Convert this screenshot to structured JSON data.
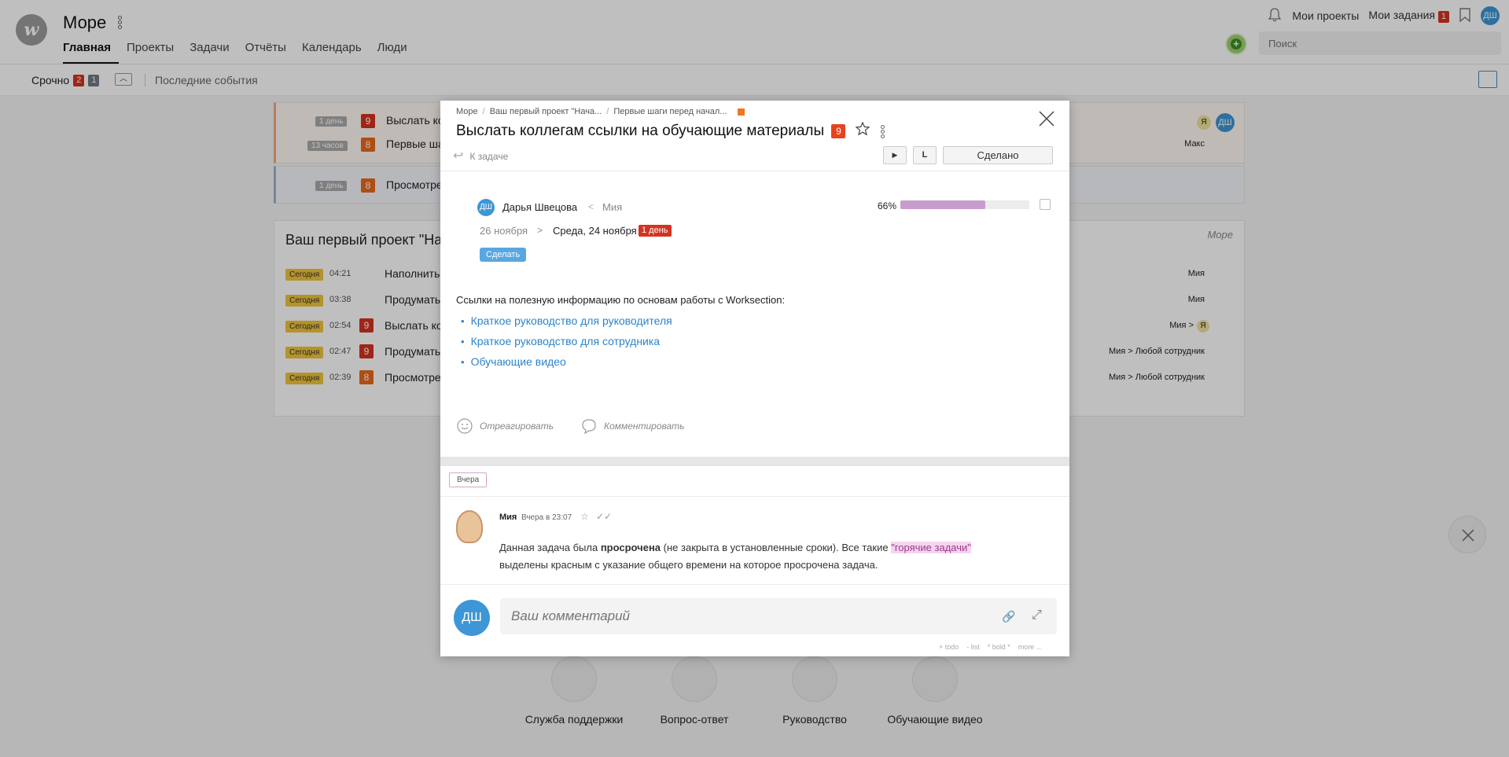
{
  "header": {
    "logo": "w",
    "title": "Море",
    "nav": [
      "Главная",
      "Проекты",
      "Задачи",
      "Отчёты",
      "Календарь",
      "Люди"
    ],
    "my_projects": "Мои проекты",
    "my_tasks": "Мои задания",
    "my_tasks_count": "1",
    "user_initials": "ДШ",
    "search_placeholder": "Поиск"
  },
  "subbar": {
    "urgent_label": "Срочно",
    "urgent_count_red": "2",
    "urgent_count_grey": "1",
    "recent_events": "Последние события"
  },
  "background": {
    "urgent_rows": [
      {
        "time": "1 день",
        "priority": "9",
        "text": "Выслать ко",
        "assignees": [
          "Я",
          "ДШ"
        ]
      },
      {
        "time": "13 часов",
        "priority": "8",
        "text": "Первые ша",
        "assignees": [
          "Макс"
        ]
      },
      {
        "time": "1 день",
        "priority": "8",
        "text": "Просмотре",
        "assignees": []
      }
    ],
    "project_title": "Ваш первый проект \"На",
    "project_right": "Море",
    "events": [
      {
        "tag": "Сегодня",
        "time": "04:21",
        "text": "Наполнить",
        "who": "Мия"
      },
      {
        "tag": "Сегодня",
        "time": "03:38",
        "text": "Продумать",
        "who": "Мия"
      },
      {
        "tag": "Сегодня",
        "time": "02:54",
        "priority": "9",
        "text": "Выслать ко",
        "who": "Мия >",
        "who_badge": "Я"
      },
      {
        "tag": "Сегодня",
        "time": "02:47",
        "priority": "9",
        "text": "Продумать",
        "who": "Мия > Любой сотрудник"
      },
      {
        "tag": "Сегодня",
        "time": "02:39",
        "priority": "8",
        "text": "Просмотре",
        "who": "Мия > Любой сотрудник"
      }
    ]
  },
  "help": {
    "items": [
      "Служба поддержки",
      "Вопрос-ответ",
      "Руководство",
      "Обучающие видео"
    ]
  },
  "modal": {
    "breadcrumb": [
      "Море",
      "Ваш первый проект \"Нача...",
      "Первые шаги перед начал..."
    ],
    "title": "Выслать коллегам ссылки на обучающие материалы",
    "priority": "9",
    "back": "К задаче",
    "done_button": "Сделано",
    "play_glyph": "▶",
    "l_glyph": "L",
    "author_initials": "ДШ",
    "author": "Дарья Швецова",
    "arrow": "<",
    "assignee": "Мия",
    "date_start": "26 ноября",
    "date_arrow": ">",
    "date_end": "Среда, 24 ноября",
    "overdue": "1 день",
    "do_button": "Сделать",
    "progress_label": "66%",
    "progress_value": 0.66,
    "description": "Ссылки на полезную информацию по основам работы с Worksection:",
    "links": [
      "Краткое руководство для руководителя",
      "Краткое руководство для сотрудника",
      "Обучающие видео"
    ],
    "react": "Отреагировать",
    "comment": "Комментировать",
    "day_label": "Вчера",
    "comment_author": "Мия",
    "comment_time": "Вчера в 23:07",
    "comment_text_1": "Данная задача была ",
    "comment_bold": "просрочена",
    "comment_text_2": " (не закрыта в установленные сроки). Все такие ",
    "comment_highlight": "\"горячие задачи\"",
    "comment_text_3": "выделены красным с указание общего времени на которое просрочена задача.",
    "input_initials": "ДШ",
    "input_placeholder": "Ваш комментарий",
    "formatting": [
      "+ todo",
      "- list",
      "* bold *",
      "more ..."
    ]
  },
  "colors": {
    "accent": "#2b83cc",
    "priority_orange": "#e8681b",
    "overdue_red": "#d4331f",
    "progress": "#c89ccd"
  }
}
